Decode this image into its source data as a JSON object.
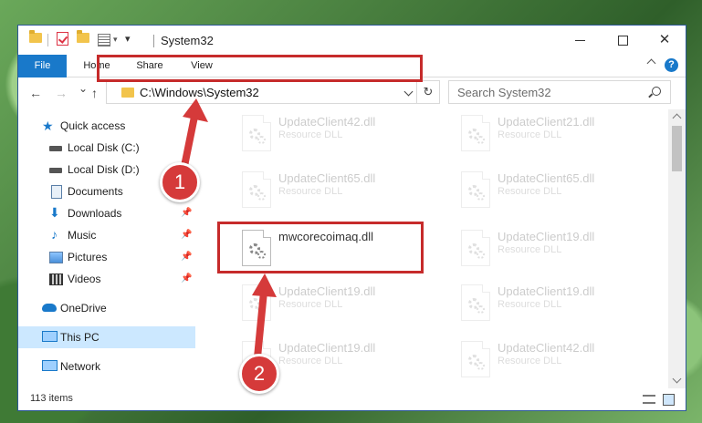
{
  "window": {
    "title": "System32",
    "controls": [
      "—",
      "☐",
      "✕"
    ]
  },
  "ribbon": {
    "tabs": [
      "File",
      "Home",
      "Share",
      "View"
    ],
    "help": "?"
  },
  "navigation": {
    "back": "←",
    "forward": "→",
    "recent": "⌄",
    "up": "↑",
    "address": "C:\\Windows\\System32",
    "search_placeholder": "Search System32",
    "refresh": "↻"
  },
  "sidebar": {
    "items": [
      {
        "label": "Quick access",
        "icon": "star-icon",
        "pinned": false
      },
      {
        "label": "Local Disk (C:)",
        "icon": "drive-icon",
        "pinned": false
      },
      {
        "label": "Local Disk (D:)",
        "icon": "drive-icon",
        "pinned": false
      },
      {
        "label": "Documents",
        "icon": "documents-icon",
        "pinned": false
      },
      {
        "label": "Downloads",
        "icon": "download-icon",
        "pinned": true
      },
      {
        "label": "Music",
        "icon": "music-icon",
        "pinned": true
      },
      {
        "label": "Pictures",
        "icon": "pictures-icon",
        "pinned": true
      },
      {
        "label": "Videos",
        "icon": "video-icon",
        "pinned": true
      },
      {
        "label": "OneDrive",
        "icon": "cloud-icon",
        "pinned": false
      },
      {
        "label": "This PC",
        "icon": "computer-icon",
        "pinned": false,
        "selected": true
      },
      {
        "label": "Network",
        "icon": "network-icon",
        "pinned": false
      }
    ]
  },
  "files": [
    {
      "name": "UpdateClient42.dll",
      "desc": "Resource DLL"
    },
    {
      "name": "UpdateClient21.dll",
      "desc": "Resource DLL"
    },
    {
      "name": "UpdateClient65.dll",
      "desc": "Resource DLL"
    },
    {
      "name": "UpdateClient65.dll",
      "desc": "Resource DLL"
    },
    {
      "name": "mwcorecoimaq.dll",
      "desc": ""
    },
    {
      "name": "UpdateClient19.dll",
      "desc": "Resource DLL"
    },
    {
      "name": "UpdateClient19.dll",
      "desc": "Resource DLL"
    },
    {
      "name": "UpdateClient19.dll",
      "desc": "Resource DLL"
    },
    {
      "name": "UpdateClient19.dll",
      "desc": "Resource DLL"
    },
    {
      "name": "UpdateClient42.dll",
      "desc": "Resource DLL"
    }
  ],
  "status": {
    "item_count": "113 items"
  },
  "callouts": [
    "1",
    "2"
  ],
  "colors": {
    "accent": "#1979ca",
    "highlight": "#c62b2b",
    "selected": "#cce8ff"
  }
}
